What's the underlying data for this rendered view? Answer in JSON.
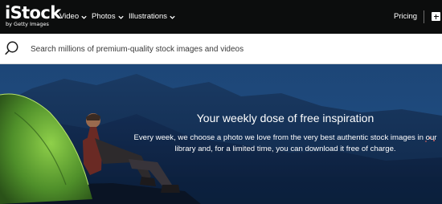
{
  "brand": {
    "logo_word": "iStock",
    "logo_sub": "by Getty Images"
  },
  "nav": {
    "items": [
      {
        "label": "Video"
      },
      {
        "label": "Photos"
      },
      {
        "label": "Illustrations"
      }
    ],
    "pricing_label": "Pricing",
    "icons": [
      "chevron-down-icon",
      "add-to-board-icon"
    ]
  },
  "search": {
    "placeholder": "Search millions of premium-quality stock images and videos",
    "value": "",
    "icon": "search-icon"
  },
  "hero": {
    "title": "Your weekly dose of free inspiration",
    "body": "Every week, we choose a photo we love from the very best authentic stock images in our library and, for a limited time, you can download it free of charge."
  },
  "colors": {
    "nav_bg": "#0c0d0d",
    "nav_text": "#ffffff",
    "hero_sky": "#1c4576",
    "tent_green": "#4f8f2a"
  }
}
